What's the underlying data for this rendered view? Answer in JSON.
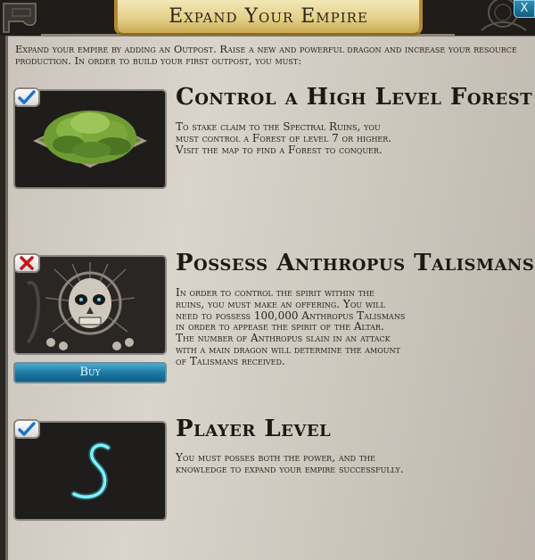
{
  "dialog": {
    "title": "Expand Your Empire",
    "close_label": "X",
    "intro": "Expand your empire by adding an Outpost. Raise a new and powerful dragon and increase your resource production. In order to build your first outpost, you must:"
  },
  "requirements": [
    {
      "title": "Control a High Level Forest",
      "description": "To stake claim to the Spectral Ruins, you must control a Forest of level 7 or higher. Visit the map to find a Forest to conquer.",
      "status": "complete",
      "status_icon": "checkmark-icon"
    },
    {
      "title": "Possess Anthropus Talismans",
      "description": "In order to control the spirit within the ruins, you must make an offering. You will need to possess 100,000 Anthropus Talismans in order to appease the spirit of the Altar. The number of Anthropus slain in an attack with a main dragon will determine the amount of Talismans received.",
      "status": "incomplete",
      "status_icon": "x-mark-icon",
      "button_label": "Buy"
    },
    {
      "title": "Player Level",
      "description": "You must posses both the power, and the knowledge to expand your empire successfully.",
      "status": "complete",
      "status_icon": "checkmark-icon"
    }
  ],
  "colors": {
    "check_blue": "#1c74c9",
    "x_red": "#c8141b",
    "buy_blue": "#1d7aa4",
    "title_gold": "#e4d18a"
  }
}
